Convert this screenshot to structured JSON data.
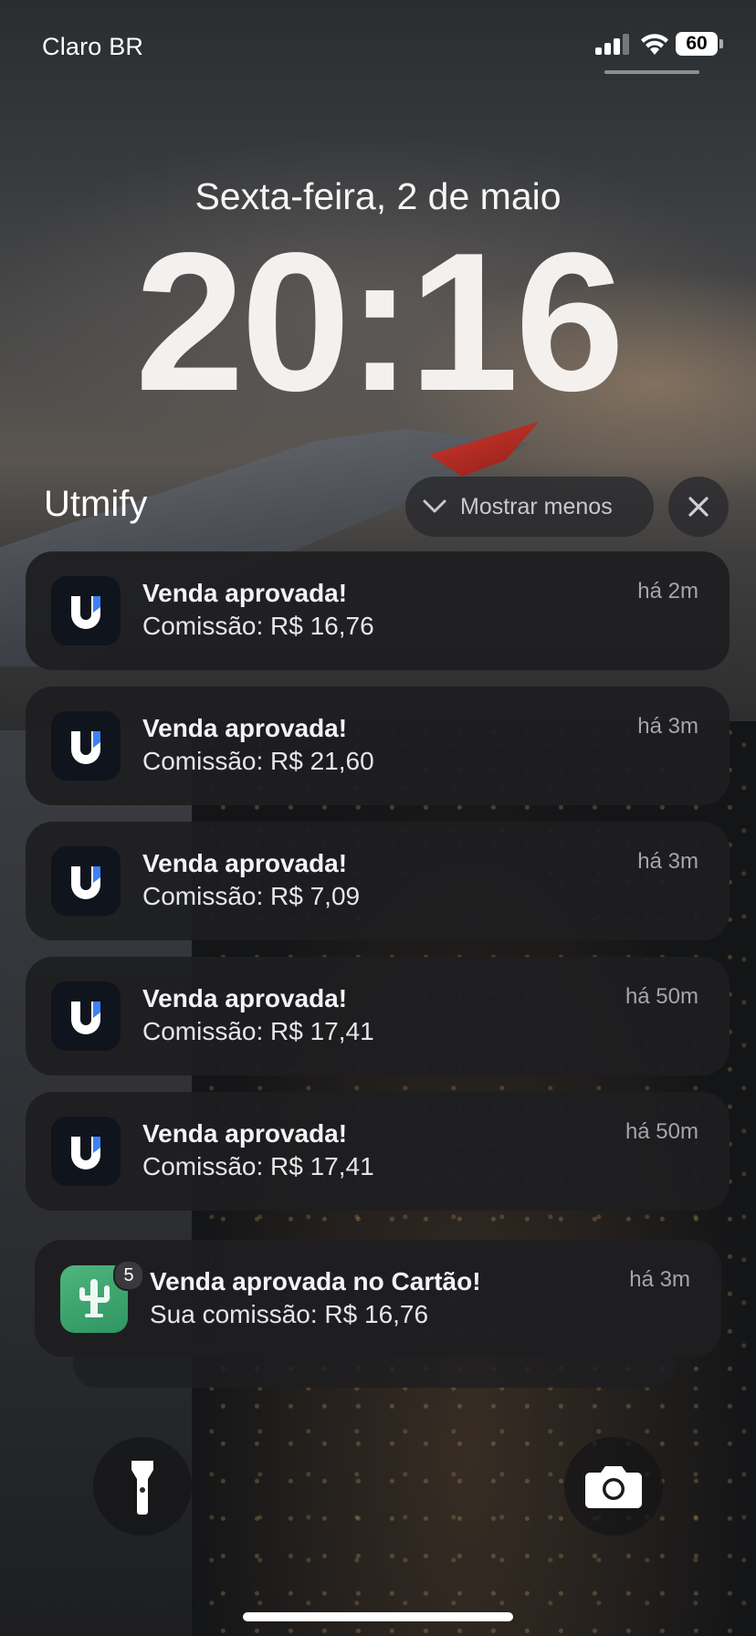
{
  "status_bar": {
    "carrier": "Claro BR",
    "battery_level": "60",
    "signal_bars": 3,
    "wifi": true
  },
  "lock_screen": {
    "date": "Sexta-feira, 2 de maio",
    "time": "20:16"
  },
  "notification_group": {
    "app_name": "Utmify",
    "show_less_label": "Mostrar menos",
    "icons": {
      "chevron": "chevron-down-icon",
      "close": "close-icon"
    }
  },
  "notifications": [
    {
      "title": "Venda aprovada!",
      "body": "Comissão: R$ 16,76",
      "time": "há 2m"
    },
    {
      "title": "Venda aprovada!",
      "body": "Comissão: R$ 21,60",
      "time": "há 3m"
    },
    {
      "title": "Venda aprovada!",
      "body": "Comissão: R$ 7,09",
      "time": "há 3m"
    },
    {
      "title": "Venda aprovada!",
      "body": "Comissão: R$ 17,41",
      "time": "há 50m"
    },
    {
      "title": "Venda aprovada!",
      "body": "Comissão: R$ 17,41",
      "time": "há 50m"
    }
  ],
  "stacked_notification": {
    "title": "Venda aprovada no Cartão!",
    "body": "Sua comissão: R$ 16,76",
    "time": "há 3m",
    "badge_count": "5",
    "icon": "cactus-icon"
  },
  "controls": {
    "flashlight": "flashlight-icon",
    "camera": "camera-icon"
  },
  "colors": {
    "notification_bg": "#1e1e20",
    "utmify_icon_bg": "#0f141d",
    "utmify_accent": "#3b82f6",
    "cactus_green": "#3fa56f"
  }
}
